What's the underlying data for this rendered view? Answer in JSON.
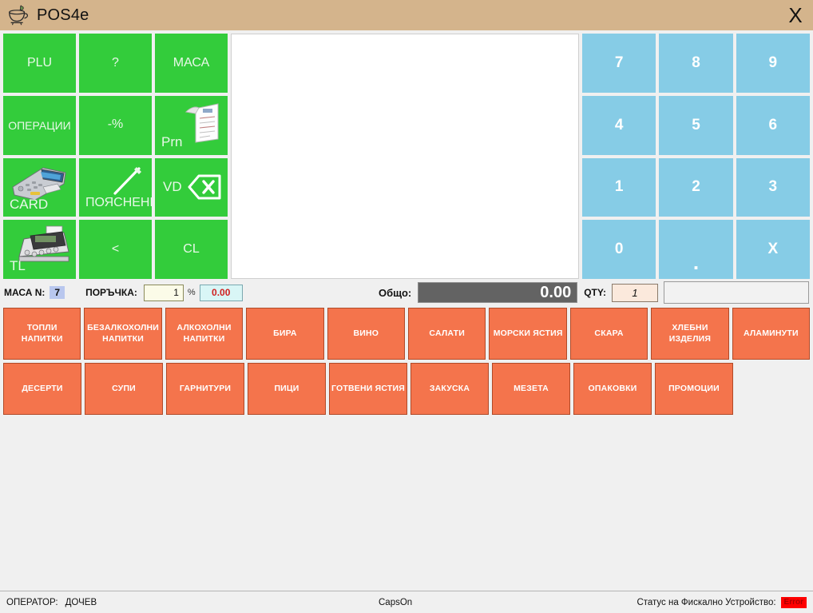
{
  "window": {
    "title": "POS4e",
    "icon": "coffee-cup-icon",
    "close_label": "X",
    "titlebar_color": "#d4b48c"
  },
  "function_pad": {
    "color": "#33cc3b",
    "buttons": [
      {
        "label": "PLU",
        "icon": "",
        "style": "center"
      },
      {
        "label": "?",
        "icon": "",
        "style": "center"
      },
      {
        "label": "МАСА",
        "icon": "",
        "style": "center"
      },
      {
        "label": "ОПЕРАЦИИ",
        "icon": "",
        "style": "center"
      },
      {
        "label": "-%",
        "icon": "",
        "style": "center"
      },
      {
        "label": "Prn",
        "icon": "receipt-icon",
        "style": "bottom-left"
      },
      {
        "label": "CARD",
        "icon": "card-terminal-icon",
        "style": "bottom-left"
      },
      {
        "label": "ПОЯСНЕНИЕ",
        "icon": "pencil-icon",
        "style": "bottom-left"
      },
      {
        "label": "VD",
        "icon": "backspace-icon",
        "style": "left-middle"
      },
      {
        "label": "TL",
        "icon": "cash-register-icon",
        "style": "bottom-left"
      },
      {
        "label": "<",
        "icon": "",
        "style": "center"
      },
      {
        "label": "CL",
        "icon": "",
        "style": "center"
      }
    ]
  },
  "keypad": {
    "color": "#86cce6",
    "keys": [
      "7",
      "8",
      "9",
      "4",
      "5",
      "6",
      "1",
      "2",
      "3",
      "0",
      ".",
      "X"
    ]
  },
  "order_display": {
    "items": [],
    "background": "#ffffff"
  },
  "infobar": {
    "masa_label": "МАСА N:",
    "masa_value": "7",
    "porachka_label": "ПОРЪЧКА:",
    "porachka_value": "1",
    "percent_symbol": "%",
    "discount_value": "0.00",
    "discount_color": "#d02020",
    "total_label": "Общо:",
    "total_value": "0.00",
    "qty_label": "QTY:",
    "qty_value": "1",
    "free_input_value": "",
    "free_input_placeholder": ""
  },
  "categories": {
    "color": "#f4744c",
    "row1": [
      "ТОПЛИ НАПИТКИ",
      "БЕЗАЛКОХОЛНИ НАПИТКИ",
      "АЛКОХОЛНИ НАПИТКИ",
      "БИРА",
      "ВИНО",
      "САЛАТИ",
      "МОРСКИ ЯСТИЯ",
      "СКАРА",
      "ХЛЕБНИ ИЗДЕЛИЯ",
      "АЛАМИНУТИ"
    ],
    "row2": [
      "ДЕСЕРТИ",
      "СУПИ",
      "ГАРНИТУРИ",
      "ПИЦИ",
      "ГОТВЕНИ ЯСТИЯ",
      "ЗАКУСКА",
      "МЕЗЕТА",
      "ОПАКОВКИ",
      "ПРОМОЦИИ"
    ]
  },
  "statusbar": {
    "operator_label": "ОПЕРАТОР:",
    "operator_name": "ДОЧЕВ",
    "caps_state": "CapsOn",
    "fiscal_label": "Статус на Фискално Устройство:",
    "fiscal_status": "Error",
    "fiscal_status_color": "#ff0000"
  }
}
